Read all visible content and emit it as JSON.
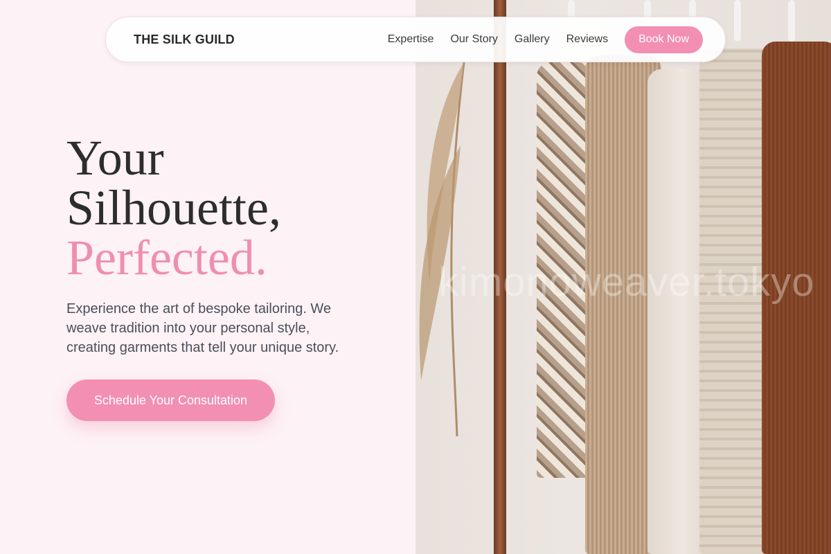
{
  "header": {
    "brand": "THE SILK GUILD",
    "nav": [
      "Expertise",
      "Our Story",
      "Gallery",
      "Reviews"
    ],
    "book_label": "Book Now"
  },
  "hero": {
    "title_line1": "Your",
    "title_line2": "Silhouette,",
    "title_accent": "Perfected.",
    "description": "Experience the art of bespoke tailoring. We weave tradition into your personal style, creating garments that tell your unique story.",
    "cta_label": "Schedule Your Consultation"
  },
  "image": {
    "watermark": "kimonoweaver.tokyo"
  },
  "colors": {
    "accent": "#f28fb2",
    "background": "#fdf2f5",
    "heading": "#2d2d2d"
  }
}
